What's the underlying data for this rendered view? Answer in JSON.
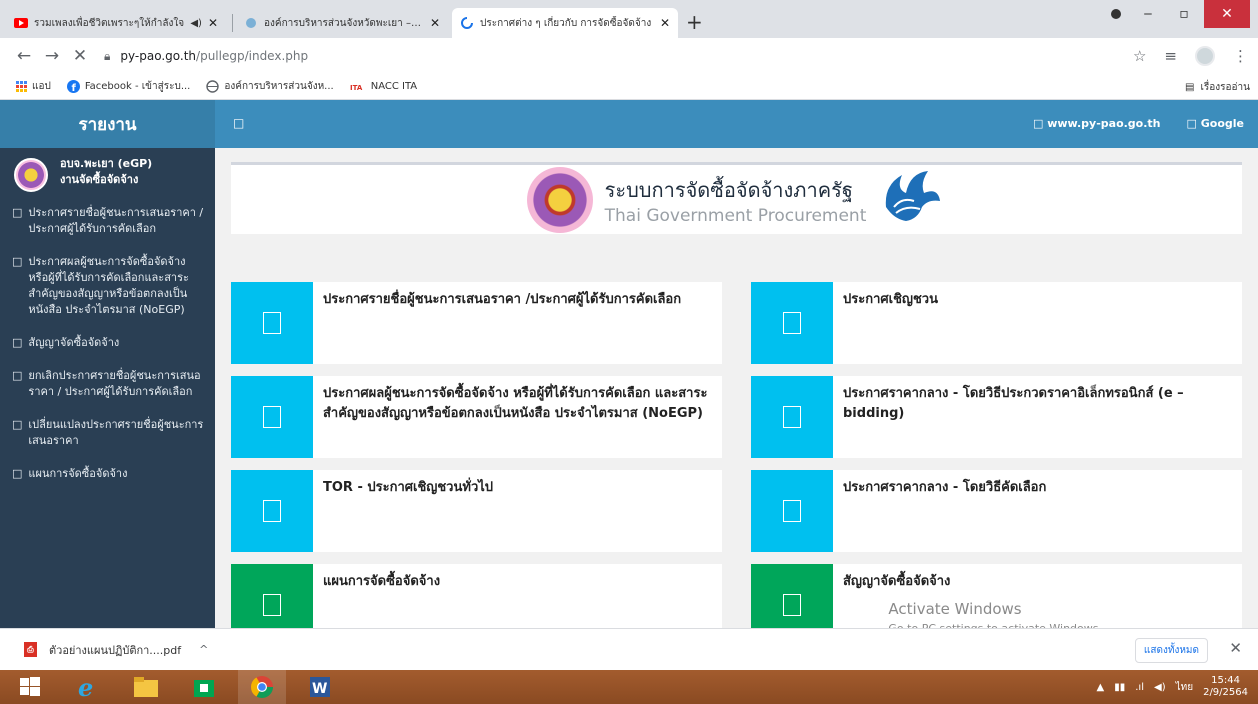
{
  "browser": {
    "tabs": [
      {
        "title": "รวมเพลงเพื่อชีวิตเพราะๆให้กำลังใจ",
        "icon": "youtube-icon",
        "active": false
      },
      {
        "title": "องค์การบริหารส่วนจังหวัดพะเยา – Pha",
        "icon": "site-icon",
        "active": false
      },
      {
        "title": "ประกาศต่าง ๆ เกี่ยวกับ การจัดซื้อจัดจ้าง",
        "icon": "loading-icon",
        "active": true
      }
    ],
    "new_tab": "+",
    "url_host": "py-pao.go.th",
    "url_path": "/pullegp/index.php",
    "bookmarks": [
      {
        "label": "แอป",
        "icon": "apps-grid-icon"
      },
      {
        "label": "Facebook - เข้าสู่ระบ...",
        "icon": "facebook-icon"
      },
      {
        "label": "องค์การบริหารส่วนจังห...",
        "icon": "globe-icon"
      },
      {
        "label": "NACC ITA",
        "icon": "ita-icon"
      }
    ],
    "reading_list": "เรื่องรออ่าน"
  },
  "sidebar": {
    "title": "รายงาน",
    "profile_line1": "อบจ.พะเยา (eGP)",
    "profile_line2": "งานจัดซื้อจัดจ้าง",
    "glyph": "□",
    "items": [
      {
        "label": "ประกาศรายชื่อผู้ชนะการเสนอราคา / ประกาศผู้ได้รับการคัดเลือก"
      },
      {
        "label": "ประกาศผลผู้ชนะการจัดซื้อจัดจ้าง หรือผู้ที่ได้รับการคัดเลือกและสาระสำคัญของสัญญาหรือข้อตกลงเป็นหนังสือ ประจำไตรมาส (NoEGP)"
      },
      {
        "label": "สัญญาจัดซื้อจัดจ้าง"
      },
      {
        "label": "ยกเลิกประกาศรายชื่อผู้ชนะการเสนอราคา / ประกาศผู้ได้รับการคัดเลือก"
      },
      {
        "label": "เปลี่ยนแปลงประกาศรายชื่อผู้ชนะการเสนอราคา"
      },
      {
        "label": "แผนการจัดซื้อจัดจ้าง"
      }
    ]
  },
  "topnav": {
    "toggle": "□",
    "link1": "□ www.py-pao.go.th",
    "link2": "□ Google"
  },
  "banner": {
    "title_th": "ระบบการจัดซื้อจัดจ้างภาครัฐ",
    "title_en": "Thai Government Procurement"
  },
  "cards": [
    {
      "label": "ประกาศรายชื่อผู้ชนะการเสนอราคา /ประกาศผู้ได้รับการคัดเลือก",
      "color": "#00c0ef"
    },
    {
      "label": "ประกาศเชิญชวน",
      "color": "#00c0ef"
    },
    {
      "label": "ประกาศผลผู้ชนะการจัดซื้อจัดจ้าง หรือผู้ที่ได้รับการคัดเลือก และสาระสำคัญของสัญญาหรือข้อตกลงเป็นหนังสือ ประจำไตรมาส (NoEGP)",
      "color": "#00c0ef"
    },
    {
      "label": "ประกาศราคากลาง - โดยวิธีประกวดราคาอิเล็กทรอนิกส์ (e – bidding)",
      "color": "#00c0ef"
    },
    {
      "label": "TOR - ประกาศเชิญชวนทั่วไป",
      "color": "#00c0ef"
    },
    {
      "label": "ประกาศราคากลาง - โดยวิธีคัดเลือก",
      "color": "#00c0ef"
    },
    {
      "label": "แผนการจัดซื้อจัดจ้าง",
      "color": "#00a65a"
    },
    {
      "label": "สัญญาจัดซื้อจัดจ้าง",
      "color": "#00a65a"
    }
  ],
  "watermark": {
    "line1": "Activate Windows",
    "line2": "Go to PC settings to activate Windows."
  },
  "downloads": {
    "file": "ตัวอย่างแผนปฏิบัติกา....pdf",
    "show_all": "แสดงทั้งหมด"
  },
  "taskbar": {
    "lang": "ไทย",
    "time": "15:44",
    "date": "2/9/2564"
  }
}
